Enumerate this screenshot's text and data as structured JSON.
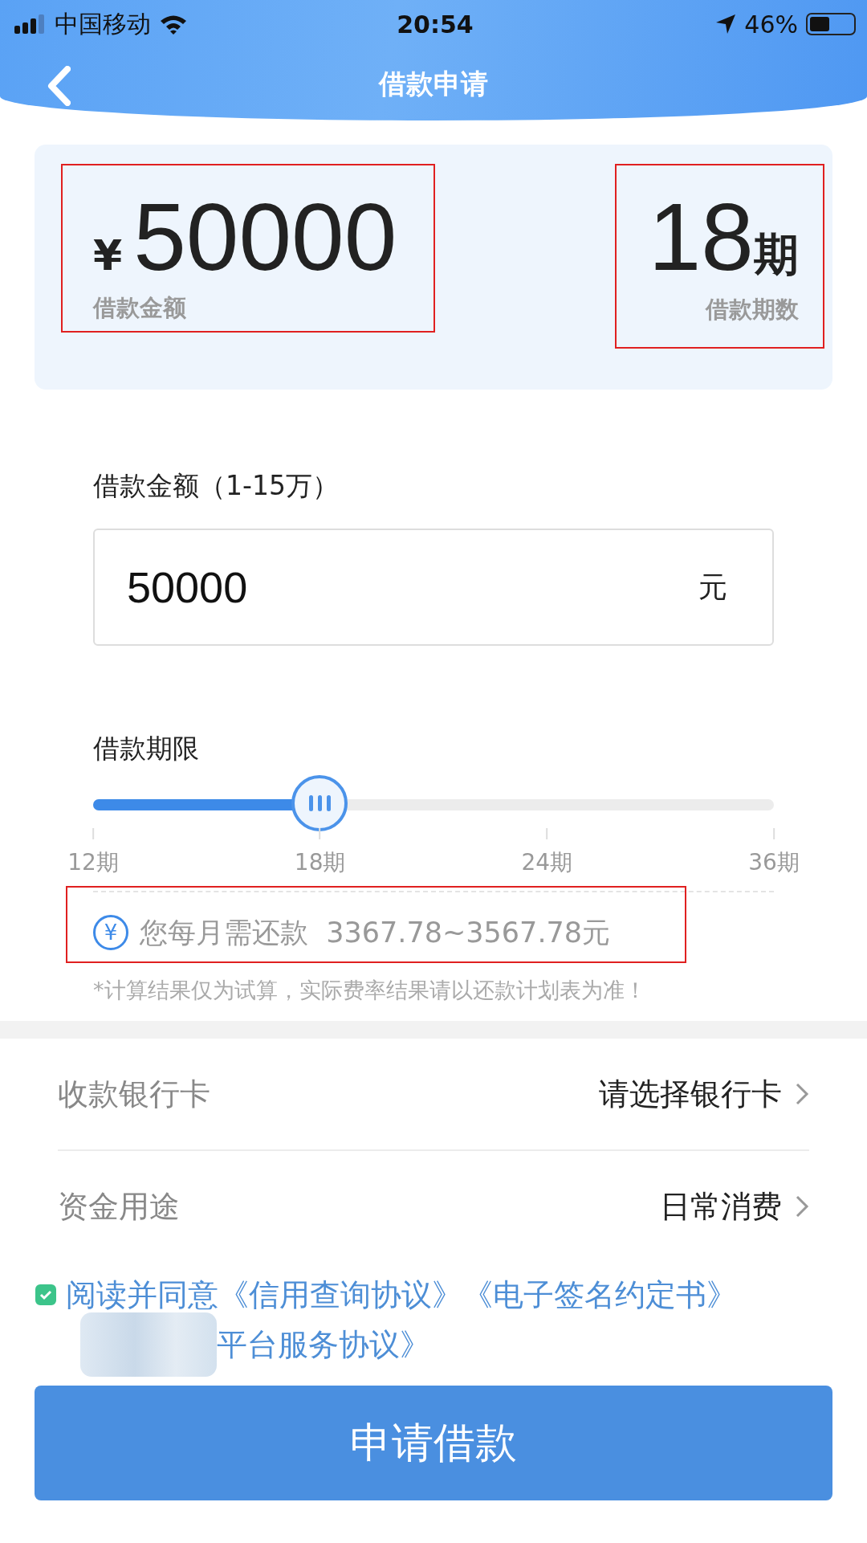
{
  "status_bar": {
    "carrier": "中国移动",
    "time": "20:54",
    "battery_text": "46%"
  },
  "header": {
    "title": "借款申请"
  },
  "summary": {
    "currency": "¥",
    "amount": "50000",
    "amount_label": "借款金额",
    "term_number": "18",
    "term_unit": "期",
    "term_label": "借款期数"
  },
  "amount_field": {
    "label": "借款金额（1-15万）",
    "value": "50000",
    "unit": "元"
  },
  "term_slider": {
    "label": "借款期限",
    "level": 0.333,
    "ticks": [
      "12期",
      "18期",
      "24期",
      "36期"
    ]
  },
  "repayment": {
    "icon_char": "¥",
    "text": "您每月需还款  3367.78~3567.78元",
    "note": "*计算结果仅为试算，实际费率结果请以还款计划表为准！"
  },
  "rows": [
    {
      "label": "收款银行卡",
      "value": "请选择银行卡"
    },
    {
      "label": "资金用途",
      "value": "日常消费"
    }
  ],
  "agreement": {
    "checked": true,
    "text": "阅读并同意《信用查询协议》《电子签名约定书》",
    "text_line2": "平台服务协议》"
  },
  "submit_button": "申请借款"
}
